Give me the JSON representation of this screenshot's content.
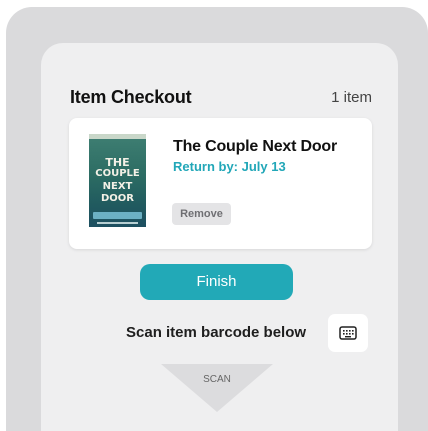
{
  "header": {
    "title": "Item Checkout",
    "count": "1 item"
  },
  "items": [
    {
      "title": "The Couple Next Door",
      "return_label": "Return by: July 13",
      "remove_label": "Remove",
      "cover_lines": [
        "THE",
        "COUPLE",
        "NEXT",
        "DOOR"
      ]
    }
  ],
  "actions": {
    "finish_label": "Finish"
  },
  "scan": {
    "instruction": "Scan item barcode below",
    "arrow_label": "SCAN",
    "keyboard_icon": "keyboard-icon"
  },
  "colors": {
    "accent": "#22a9b7",
    "return_text": "#22a7b8",
    "frame": "#dadadc",
    "panel": "#efeff0",
    "card": "#ffffff",
    "remove_bg": "#e4e4e6",
    "scan_arrow": "#dcdcde"
  }
}
